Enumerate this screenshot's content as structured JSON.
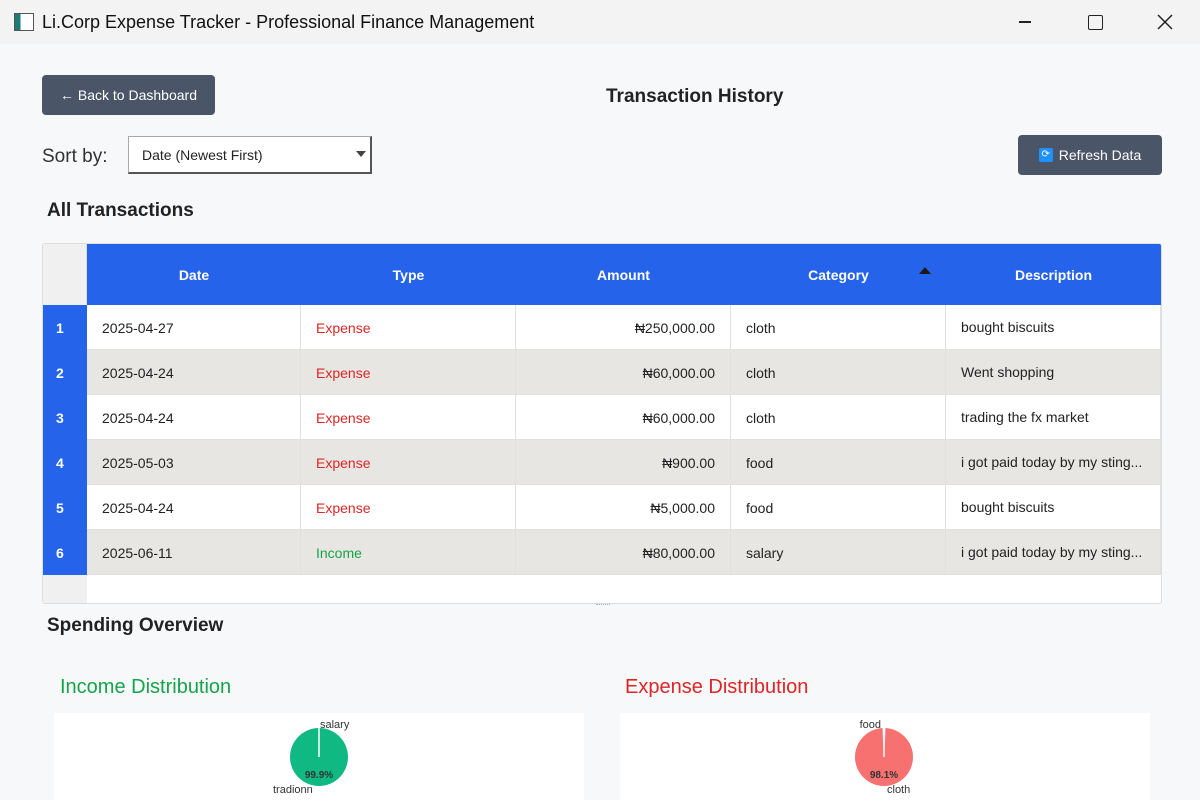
{
  "window": {
    "title": "Li.Corp Expense Tracker - Professional Finance Management",
    "icon": "app-window-icon"
  },
  "header": {
    "back_label": "← Back to Dashboard",
    "page_title": "Transaction History"
  },
  "sort": {
    "label": "Sort by:",
    "selected": "Date (Newest First)"
  },
  "refresh": {
    "label": "Refresh Data",
    "icon": "refresh-icon"
  },
  "transactions": {
    "section_title": "All Transactions",
    "columns": [
      "Date",
      "Type",
      "Amount",
      "Category",
      "Description"
    ],
    "sorted_column": "Category",
    "sort_direction": "ascending",
    "rows": [
      {
        "num": "1",
        "date": "2025-04-27",
        "type": "Expense",
        "amount": "₦250,000.00",
        "category": "cloth",
        "description": "bought biscuits"
      },
      {
        "num": "2",
        "date": "2025-04-24",
        "type": "Expense",
        "amount": "₦60,000.00",
        "category": "cloth",
        "description": "Went shopping"
      },
      {
        "num": "3",
        "date": "2025-04-24",
        "type": "Expense",
        "amount": "₦60,000.00",
        "category": "cloth",
        "description": "trading the fx market"
      },
      {
        "num": "4",
        "date": "2025-05-03",
        "type": "Expense",
        "amount": "₦900.00",
        "category": "food",
        "description": "i got paid today by my sting..."
      },
      {
        "num": "5",
        "date": "2025-04-24",
        "type": "Expense",
        "amount": "₦5,000.00",
        "category": "food",
        "description": "bought biscuits"
      },
      {
        "num": "6",
        "date": "2025-06-11",
        "type": "Income",
        "amount": "₦80,000.00",
        "category": "salary",
        "description": "i got paid today by my sting..."
      }
    ]
  },
  "overview": {
    "section_title": "Spending Overview",
    "income": {
      "title": "Income Distribution",
      "color": "#10b981",
      "slices": [
        {
          "label": "salary",
          "pct": 99.9,
          "pct_label": "99.9%"
        },
        {
          "label": "tradionn",
          "pct": 0.1,
          "pct_label": ""
        }
      ]
    },
    "expense": {
      "title": "Expense Distribution",
      "color": "#f87171",
      "slices": [
        {
          "label": "cloth",
          "pct": 98.1,
          "pct_label": "98.1%"
        },
        {
          "label": "food",
          "pct": 1.9,
          "pct_label": ""
        }
      ]
    }
  },
  "colors": {
    "header_blue": "#2563eb",
    "button_gray": "#4a5568",
    "expense_red": "#dc2626",
    "income_green": "#16a34a"
  }
}
